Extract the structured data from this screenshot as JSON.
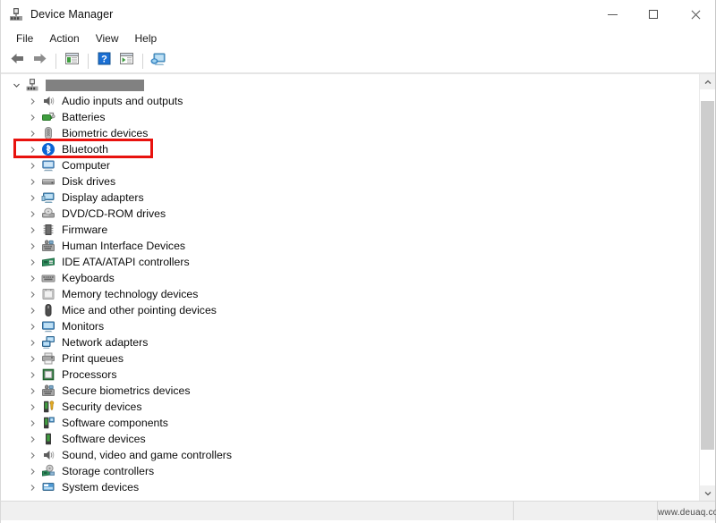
{
  "window": {
    "title": "Device Manager",
    "title_icon": "device-manager-icon",
    "minimize_label": "Minimize",
    "maximize_label": "Maximize",
    "close_label": "Close"
  },
  "menubar": {
    "items": [
      {
        "label": "File"
      },
      {
        "label": "Action"
      },
      {
        "label": "View"
      },
      {
        "label": "Help"
      }
    ]
  },
  "toolbar": {
    "buttons": [
      {
        "name": "back-arrow-icon",
        "title": "Back"
      },
      {
        "name": "forward-arrow-icon",
        "title": "Forward"
      },
      {
        "name": "show-hide-console-tree-icon",
        "title": "Show/Hide console tree"
      },
      {
        "name": "help-icon",
        "title": "Help"
      },
      {
        "name": "properties-icon",
        "title": "Properties"
      },
      {
        "name": "scan-for-hardware-changes-icon",
        "title": "Scan for hardware changes"
      }
    ]
  },
  "tree": {
    "root": {
      "label": "",
      "redacted": true,
      "icon": "computer-root-icon",
      "expanded": true
    },
    "items": [
      {
        "label": "Audio inputs and outputs",
        "icon": "speaker-icon"
      },
      {
        "label": "Batteries",
        "icon": "battery-icon"
      },
      {
        "label": "Biometric devices",
        "icon": "fingerprint-icon"
      },
      {
        "label": "Bluetooth",
        "icon": "bluetooth-icon",
        "highlighted": true
      },
      {
        "label": "Computer",
        "icon": "computer-icon"
      },
      {
        "label": "Disk drives",
        "icon": "disk-drive-icon"
      },
      {
        "label": "Display adapters",
        "icon": "display-adapter-icon"
      },
      {
        "label": "DVD/CD-ROM drives",
        "icon": "optical-drive-icon"
      },
      {
        "label": "Firmware",
        "icon": "firmware-chip-icon"
      },
      {
        "label": "Human Interface Devices",
        "icon": "hid-icon"
      },
      {
        "label": "IDE ATA/ATAPI controllers",
        "icon": "ide-controller-icon"
      },
      {
        "label": "Keyboards",
        "icon": "keyboard-icon"
      },
      {
        "label": "Memory technology devices",
        "icon": "memory-icon"
      },
      {
        "label": "Mice and other pointing devices",
        "icon": "mouse-icon"
      },
      {
        "label": "Monitors",
        "icon": "monitor-icon"
      },
      {
        "label": "Network adapters",
        "icon": "network-adapter-icon"
      },
      {
        "label": "Print queues",
        "icon": "printer-icon"
      },
      {
        "label": "Processors",
        "icon": "processor-icon"
      },
      {
        "label": "Secure biometrics devices",
        "icon": "hid-icon"
      },
      {
        "label": "Security devices",
        "icon": "security-device-icon"
      },
      {
        "label": "Software components",
        "icon": "software-component-icon"
      },
      {
        "label": "Software devices",
        "icon": "software-device-icon"
      },
      {
        "label": "Sound, video and game controllers",
        "icon": "speaker-icon"
      },
      {
        "label": "Storage controllers",
        "icon": "storage-controller-icon"
      },
      {
        "label": "System devices",
        "icon": "system-device-icon"
      }
    ]
  },
  "scrollbar": {
    "up_label": "Scroll up",
    "down_label": "Scroll down",
    "thumb_top_pct": 3,
    "thumb_height_pct": 88
  },
  "statusbar": {
    "watermark": "www.deuaq.com"
  },
  "colors": {
    "highlight_red": "#e8120e",
    "bluetooth_blue": "#0b64d4",
    "accent_green": "#3f9e3f",
    "scrollbar_thumb": "#cdcdcd",
    "redaction_gray": "#818181"
  }
}
